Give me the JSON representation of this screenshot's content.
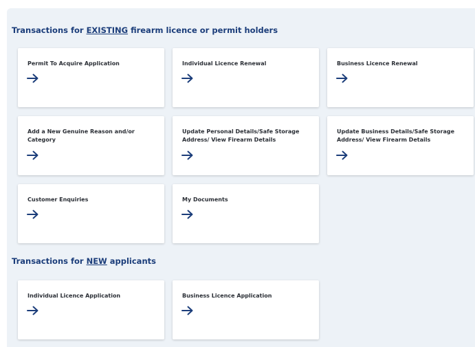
{
  "existing_section": {
    "title_prefix": "Transactions for ",
    "title_emphasis": "EXISTING",
    "title_suffix": " firearm licence or permit holders",
    "cards": [
      {
        "label": "Permit To Acquire Application",
        "icon": "arrow-right-icon"
      },
      {
        "label": "Individual Licence Renewal",
        "icon": "arrow-right-icon"
      },
      {
        "label": "Business Licence Renewal",
        "icon": "arrow-right-icon"
      },
      {
        "label": "Add a New Genuine Reason and/or Category",
        "icon": "arrow-right-icon"
      },
      {
        "label": "Update Personal Details/Safe Storage Address/ View Firearm Details",
        "icon": "arrow-right-icon"
      },
      {
        "label": "Update Business Details/Safe Storage Address/ View Firearm Details",
        "icon": "arrow-right-icon"
      },
      {
        "label": "Customer Enquiries",
        "icon": "arrow-right-icon"
      },
      {
        "label": "My Documents",
        "icon": "arrow-right-icon"
      }
    ]
  },
  "new_section": {
    "title_prefix": "Transactions for ",
    "title_emphasis": "NEW",
    "title_suffix": " applicants",
    "cards": [
      {
        "label": "Individual Licence Application",
        "icon": "arrow-right-icon"
      },
      {
        "label": "Business Licence Application",
        "icon": "arrow-right-icon"
      }
    ]
  },
  "colors": {
    "panel_background": "#edf2f7",
    "heading": "#1b3d7a",
    "arrow": "#1b3d7a",
    "card_text": "#2b2f36"
  }
}
